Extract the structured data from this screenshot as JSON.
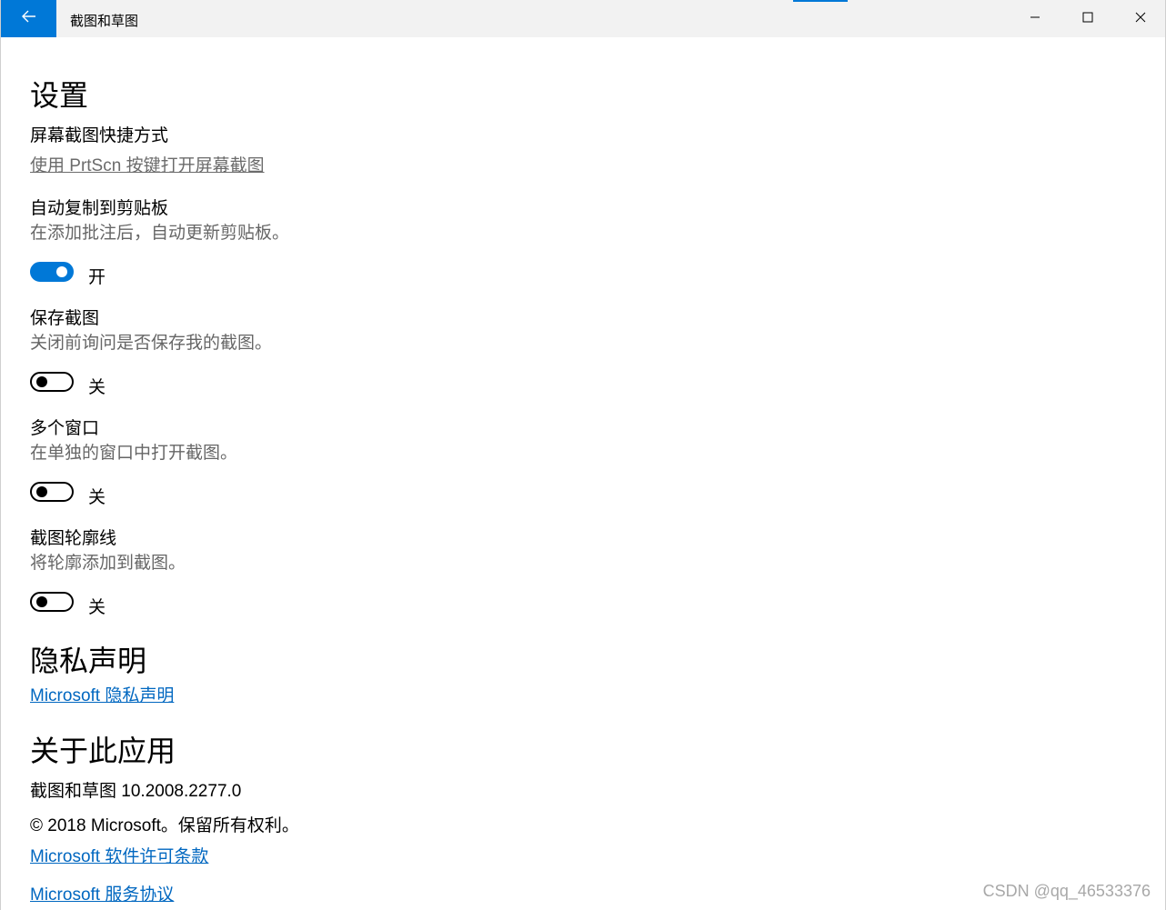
{
  "window": {
    "title": "截图和草图",
    "back_icon": "back-arrow-icon",
    "controls": [
      "minimize-icon",
      "maximize-icon",
      "close-icon"
    ]
  },
  "settings": {
    "heading": "设置",
    "shortcut": {
      "label": "屏幕截图快捷方式",
      "link": "使用 PrtScn 按键打开屏幕截图"
    },
    "auto_copy": {
      "label": "自动复制到剪贴板",
      "desc": "在添加批注后，自动更新剪贴板。",
      "state_text": "开",
      "on": true
    },
    "save_snip": {
      "label": "保存截图",
      "desc": "关闭前询问是否保存我的截图。",
      "state_text": "关",
      "on": false
    },
    "multi_window": {
      "label": "多个窗口",
      "desc": "在单独的窗口中打开截图。",
      "state_text": "关",
      "on": false
    },
    "outline": {
      "label": "截图轮廓线",
      "desc": "将轮廓添加到截图。",
      "state_text": "关",
      "on": false
    }
  },
  "privacy": {
    "heading": "隐私声明",
    "link": "Microsoft 隐私声明"
  },
  "about": {
    "heading": "关于此应用",
    "version": "截图和草图 10.2008.2277.0",
    "copyright": "© 2018 Microsoft。保留所有权利。",
    "license_link": "Microsoft 软件许可条款",
    "service_link": "Microsoft 服务协议"
  },
  "watermark": "CSDN @qq_46533376",
  "colors": {
    "accent": "#0078d7",
    "link": "#0067c0",
    "secondary_text": "#666666"
  }
}
